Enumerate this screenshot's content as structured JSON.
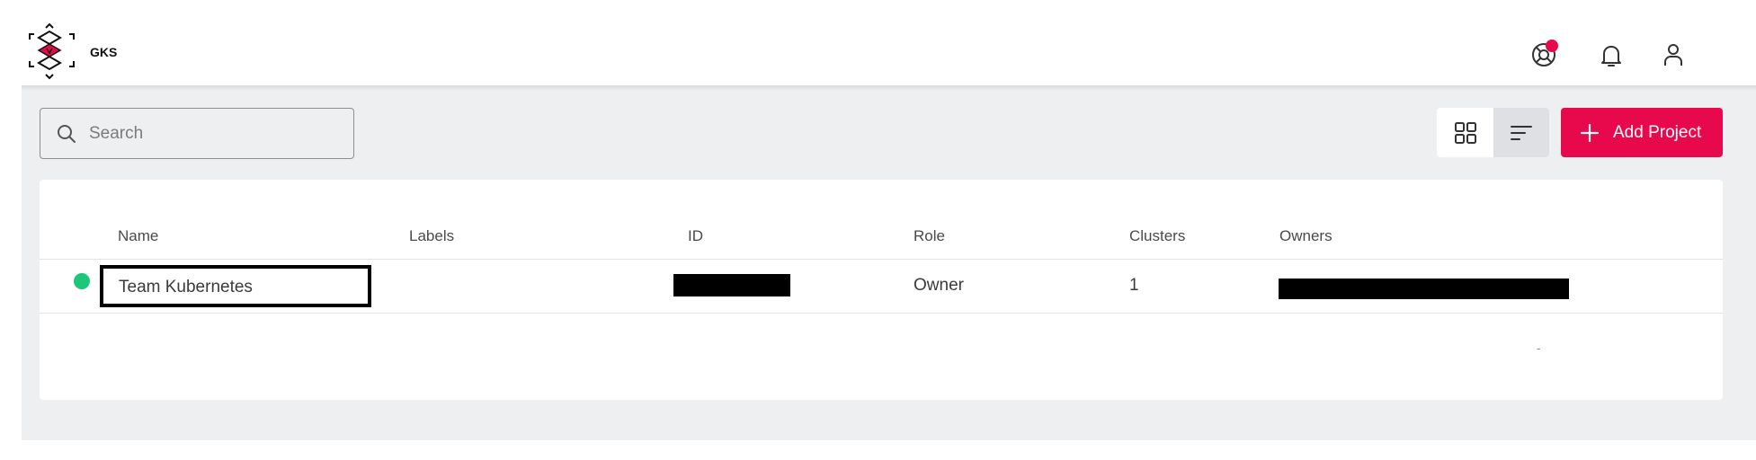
{
  "header": {
    "app_name": "GKS",
    "icons": [
      "support-icon",
      "bell-icon",
      "user-icon"
    ],
    "notification_dot_color": "#e7094c"
  },
  "toolbar": {
    "search_placeholder": "Search",
    "search_value": "",
    "view_modes": [
      "grid-view",
      "list-view"
    ],
    "active_view": "list-view",
    "add_label": "Add Project",
    "accent_color": "#e7094c"
  },
  "table": {
    "columns": [
      "Name",
      "Labels",
      "ID",
      "Role",
      "Clusters",
      "Owners"
    ],
    "rows": [
      {
        "status_color": "#1cc77a",
        "name": "Team Kubernetes",
        "labels": "",
        "id": "[redacted]",
        "role": "Owner",
        "clusters": "1",
        "owners": "[redacted]"
      }
    ],
    "pagination_text": "-"
  }
}
